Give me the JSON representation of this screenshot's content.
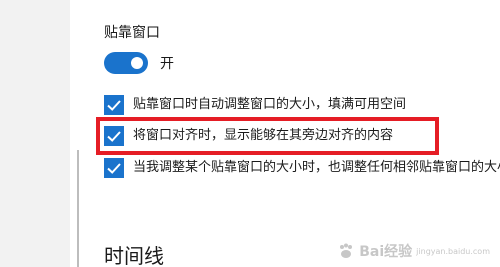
{
  "snap": {
    "section_title": "贴靠窗口",
    "toggle_label": "开",
    "toggle_on": true,
    "options": [
      {
        "label": "贴靠窗口时自动调整窗口的大小，填满可用空间",
        "checked": true
      },
      {
        "label": "将窗口对齐时，显示能够在其旁边对齐的内容",
        "checked": true
      },
      {
        "label": "当我调整某个贴靠窗口的大小时，也调整任何相邻贴靠窗口的大小",
        "checked": true
      }
    ]
  },
  "timeline": {
    "section_title": "时间线"
  },
  "watermark": {
    "text": "Bai经验",
    "sub": "jingyan.baidu.com"
  },
  "colors": {
    "accent": "#1a73cc",
    "highlight": "#e51d25"
  }
}
